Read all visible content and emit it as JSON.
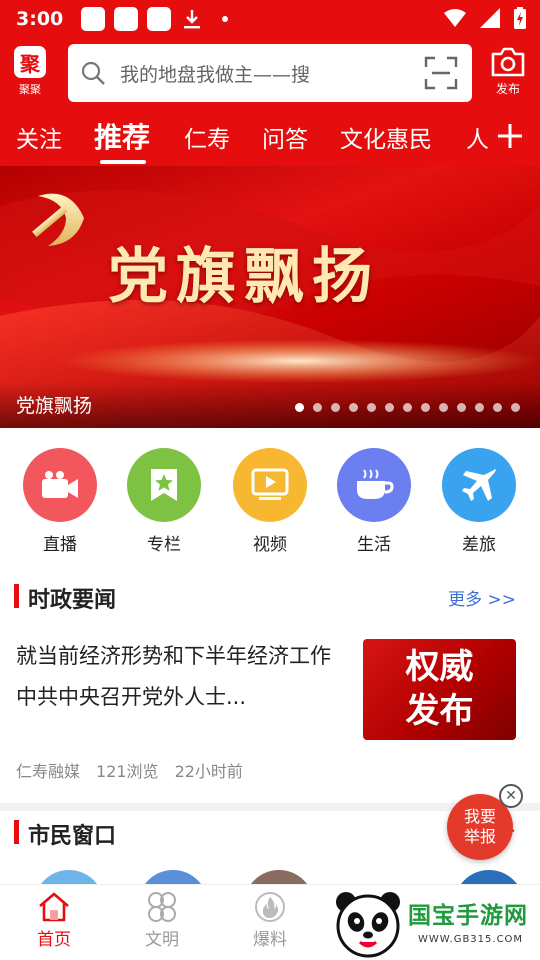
{
  "status_bar": {
    "time": "3:00",
    "icons": [
      "notification-square",
      "notification-square",
      "notification-square",
      "download-icon",
      "dot",
      "wifi-icon",
      "signal-icon",
      "battery-icon"
    ]
  },
  "header": {
    "logo_label": "聚聚",
    "search_placeholder": "我的地盘我做主——搜",
    "publish_label": "发布"
  },
  "tabs": [
    {
      "label": "关注",
      "active": false
    },
    {
      "label": "推荐",
      "active": true
    },
    {
      "label": "仁寿",
      "active": false
    },
    {
      "label": "问答",
      "active": false
    },
    {
      "label": "文化惠民",
      "active": false
    },
    {
      "label": "人",
      "active": false
    }
  ],
  "banner": {
    "headline": "党旗飘扬",
    "caption": "党旗飘扬",
    "dot_count": 13,
    "active_dot": 0
  },
  "quick_links": [
    {
      "label": "直播",
      "color": "#f2575d",
      "icon": "video-camera-icon"
    },
    {
      "label": "专栏",
      "color": "#7dc243",
      "icon": "bookmark-star-icon"
    },
    {
      "label": "视频",
      "color": "#f7b731",
      "icon": "play-screen-icon"
    },
    {
      "label": "生活",
      "color": "#6b7ff0",
      "icon": "coffee-cup-icon"
    },
    {
      "label": "差旅",
      "color": "#3aa3f0",
      "icon": "airplane-icon"
    }
  ],
  "politics_section": {
    "title": "时政要闻",
    "more": "更多 >>",
    "news": {
      "title": "就当前经济形势和下半年经济工作 中共中央召开党外人士...",
      "thumb_line1": "权威",
      "thumb_line2": "发布",
      "source": "仁寿融媒",
      "views": "121浏览",
      "time": "22小时前"
    }
  },
  "citizen_section": {
    "title": "市民窗口",
    "more": ">"
  },
  "report_float": {
    "line1": "我要",
    "line2": "举报"
  },
  "bottom_nav": [
    {
      "label": "首页",
      "icon": "home-icon",
      "active": true
    },
    {
      "label": "文明",
      "icon": "clover-icon",
      "active": false
    },
    {
      "label": "爆料",
      "icon": "fire-icon",
      "active": false
    }
  ],
  "watermark": {
    "text": "国宝手游网",
    "url": "WWW.GB315.COM"
  },
  "colors": {
    "brand_red": "#e50d0d",
    "link_blue": "#3c6fd6"
  }
}
